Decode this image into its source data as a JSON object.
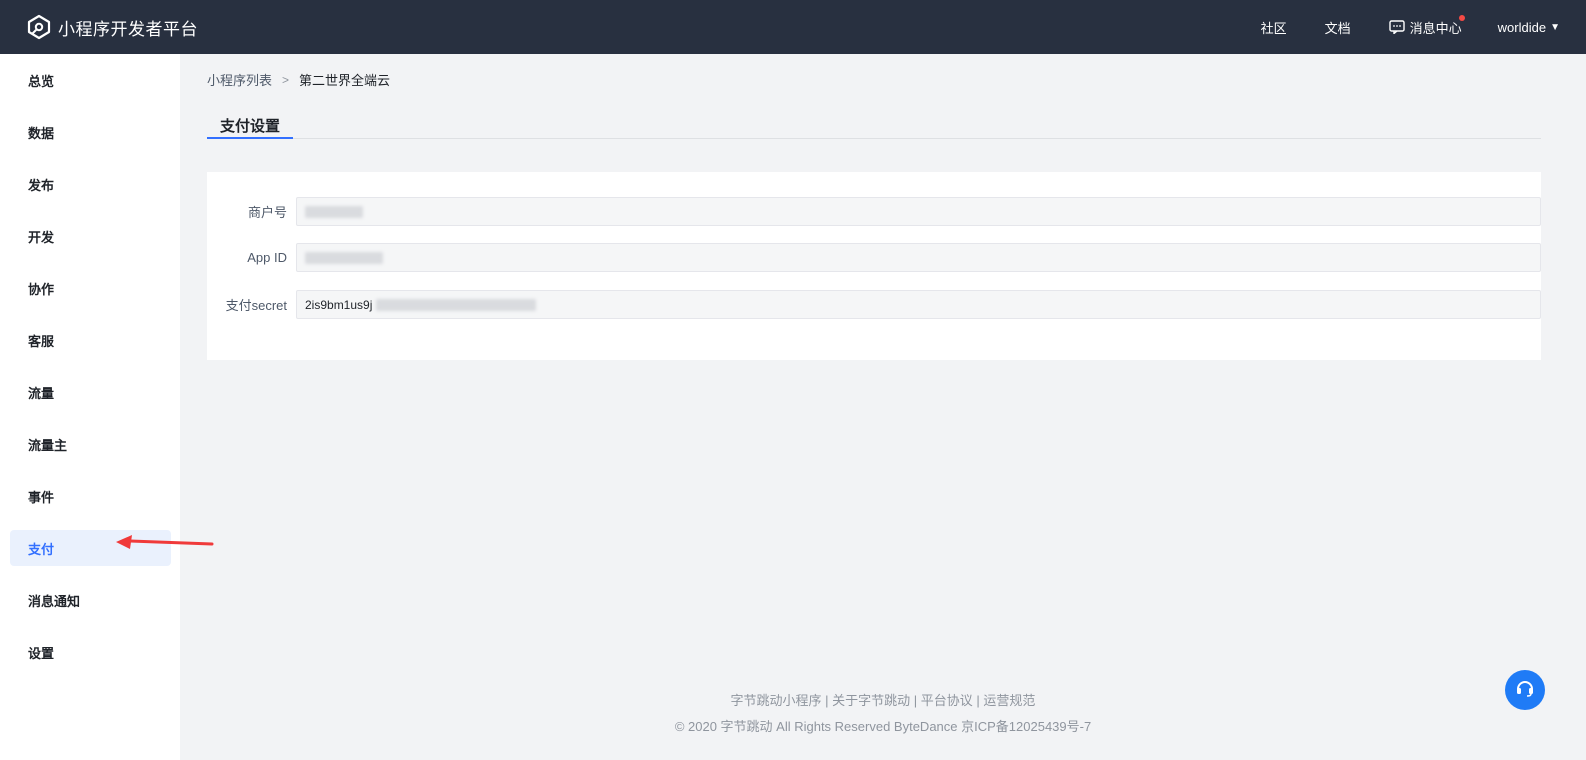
{
  "header": {
    "brand_title": "小程序开发者平台",
    "brand_icon": "platform-logo-icon",
    "nav": {
      "community": "社区",
      "docs": "文档",
      "messages": "消息中心",
      "messages_icon": "message-icon",
      "username": "worldide"
    }
  },
  "sidebar": {
    "items": [
      {
        "label": "总览"
      },
      {
        "label": "数据"
      },
      {
        "label": "发布"
      },
      {
        "label": "开发"
      },
      {
        "label": "协作"
      },
      {
        "label": "客服"
      },
      {
        "label": "流量"
      },
      {
        "label": "流量主"
      },
      {
        "label": "事件"
      },
      {
        "label": "支付",
        "active": true
      },
      {
        "label": "消息通知"
      },
      {
        "label": "设置"
      }
    ]
  },
  "breadcrumb": {
    "parent": "小程序列表",
    "separator": ">",
    "current": "第二世界全端云"
  },
  "tabs": {
    "active": "支付设置"
  },
  "form": {
    "merchant_label": "商户号",
    "app_id_label": "App ID",
    "secret_label": "支付secret",
    "secret_value_visible": "2is9bm1us9j"
  },
  "footer": {
    "links": [
      "字节跳动小程序",
      "关于字节跳动",
      "平台协议",
      "运营规范"
    ],
    "separator": " | ",
    "copyright": "© 2020 字节跳动 All Rights Reserved ByteDance 京ICP备12025439号-7"
  },
  "colors": {
    "topbar_bg": "#283040",
    "accent": "#3370ff",
    "annotation_arrow": "#f03a3a",
    "help_button": "#1f7bf6"
  }
}
